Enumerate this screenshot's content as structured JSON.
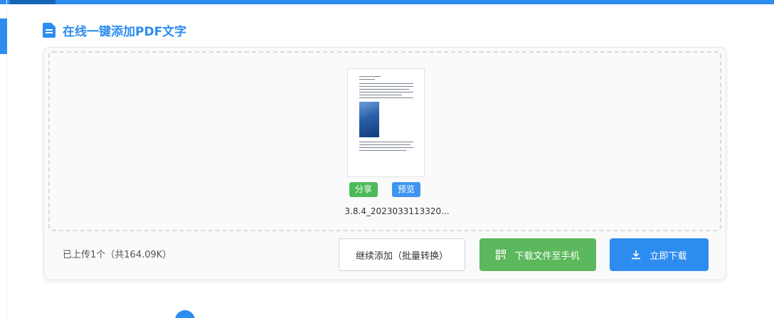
{
  "section": {
    "title": "在线一键添加PDF文字",
    "icon": "document-icon"
  },
  "file": {
    "name": "3.8.4_2023033113320...",
    "share_label": "分享",
    "preview_label": "预览"
  },
  "footer": {
    "upload_info": "已上传1个（共164.09K）",
    "continue_label": "继续添加（批量转换）",
    "phone_label": "下载文件至手机",
    "download_label": "立即下载"
  },
  "colors": {
    "accent": "#2d8cf0",
    "green": "#5cb85c"
  }
}
